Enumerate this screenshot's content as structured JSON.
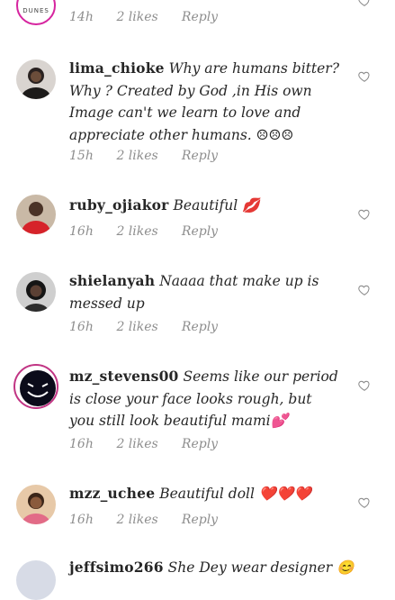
{
  "top_partial": {
    "avatar_text": "DUNES",
    "time": "14h",
    "likes": "2 likes",
    "reply": "Reply"
  },
  "comments": [
    {
      "user": "lima_chioke",
      "text": "Why are humans  bitter? Why ? Created  by God ,in His own Image can't we learn to love and appreciate other humans. ☹☹☹",
      "time": "15h",
      "likes": "2 likes",
      "reply": "Reply"
    },
    {
      "user": "ruby_ojiakor",
      "text": "Beautiful 💋",
      "time": "16h",
      "likes": "2 likes",
      "reply": "Reply"
    },
    {
      "user": "shielanyah",
      "text": "Naaaa that make up is messed up",
      "time": "16h",
      "likes": "2 likes",
      "reply": "Reply"
    },
    {
      "user": "mz_stevens00",
      "text": "Seems like our period is close your face looks rough, but you still look beautiful mami💕",
      "time": "16h",
      "likes": "2 likes",
      "reply": "Reply"
    },
    {
      "user": "mzz_uchee",
      "text": "Beautiful doll ❤️❤️❤️",
      "time": "16h",
      "likes": "2 likes",
      "reply": "Reply"
    },
    {
      "user": "jeffsimo266",
      "text": "She Dey wear designer 😊",
      "time": "",
      "likes": "",
      "reply": ""
    }
  ],
  "icons": [
    "heart-outline-icon"
  ],
  "colors": {
    "meta": "#8e8e8e",
    "text": "#262626",
    "heart_outline": "#8e8e8e"
  }
}
